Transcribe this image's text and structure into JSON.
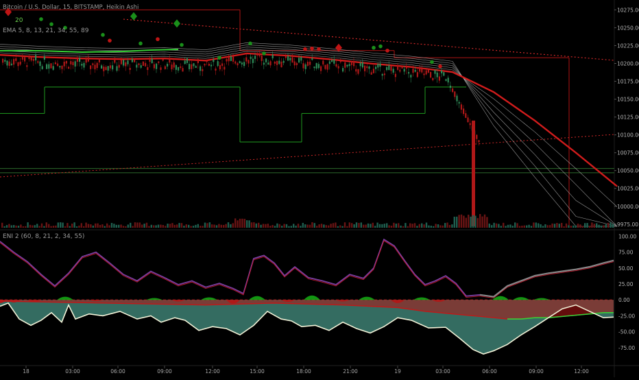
{
  "header": {
    "symbol": "Bitcoin / U.S. Dollar, 15, BITSTAMP, Heikin Ashi",
    "indicator_main": "EMA 5, 8, 13, 21, 34, 55, 89",
    "indicator_sub": "ENI 2 (60, 8, 21, 2, 34, 55)",
    "sub_value": "20"
  },
  "colors": {
    "background": "#000000",
    "up_candle": "#2e8b57",
    "down_candle": "#b01818",
    "ema_slow": "#d11c1c",
    "ema_band": "#c9c9c9",
    "channel": "#1f9d1f",
    "stop_line": "#b01515",
    "dotted_trend": "#d02828",
    "fill_teal": "#3d7f72",
    "fill_red": "#b51515",
    "fill_green": "#14b014",
    "osc_purple": "#7a3ea0",
    "osc_red": "#c0182a"
  },
  "chart_data": [
    {
      "type": "candlestick",
      "title": "Bitcoin / U.S. Dollar, 15, BITSTAMP, Heikin Ashi",
      "y_ticks": [
        "10275.00",
        "10250.00",
        "10225.00",
        "10200.00",
        "10175.00",
        "10150.00",
        "10125.00",
        "10100.00",
        "10075.00",
        "10050.00",
        "10025.00",
        "10000.00",
        "9975.00"
      ],
      "ylim": [
        9970,
        10285
      ],
      "x_ticks": [
        "18",
        "03:00",
        "06:00",
        "09:00",
        "12:00",
        "15:00",
        "18:00",
        "21:00",
        "19",
        "03:00",
        "06:00",
        "09:00",
        "12:00"
      ],
      "ema_slow_points": [
        [
          0,
          10212
        ],
        [
          60,
          10209
        ],
        [
          120,
          10207
        ],
        [
          180,
          10206
        ],
        [
          240,
          10207
        ],
        [
          300,
          10204
        ],
        [
          360,
          10214
        ],
        [
          420,
          10211
        ],
        [
          480,
          10206
        ],
        [
          540,
          10200
        ],
        [
          600,
          10195
        ],
        [
          660,
          10188
        ],
        [
          720,
          10160
        ],
        [
          780,
          10120
        ],
        [
          840,
          10075
        ],
        [
          900,
          10028
        ]
      ],
      "channel_levels": [
        {
          "from": 0,
          "to": 65,
          "value": 10130
        },
        {
          "from": 65,
          "to": 350,
          "value": 10167
        },
        {
          "from": 350,
          "to": 440,
          "value": 10090
        },
        {
          "from": 440,
          "to": 620,
          "value": 10130
        },
        {
          "from": 620,
          "to": 680,
          "value": 10167
        }
      ],
      "stop_levels": [
        {
          "from": 0,
          "to": 350,
          "value": 10275
        },
        {
          "from": 350,
          "to": 575,
          "value": 10218
        },
        {
          "from": 575,
          "to": 830,
          "value": 10208
        }
      ],
      "price_levels": [
        10053,
        10047
      ]
    },
    {
      "type": "area",
      "title": "ENI 2 (60, 8, 21, 2, 34, 55)",
      "y_ticks": [
        "100.00",
        "75.00",
        "50.00",
        "25.00",
        "0.00",
        "-25.00",
        "-50.00",
        "-75.00"
      ],
      "ylim": [
        -100,
        107
      ],
      "osc_points": [
        [
          0,
          -10
        ],
        [
          12,
          -5
        ],
        [
          28,
          -30
        ],
        [
          45,
          -40
        ],
        [
          60,
          -32
        ],
        [
          75,
          -20
        ],
        [
          90,
          -35
        ],
        [
          100,
          -8
        ],
        [
          110,
          -30
        ],
        [
          130,
          -22
        ],
        [
          150,
          -25
        ],
        [
          175,
          -18
        ],
        [
          200,
          -30
        ],
        [
          220,
          -25
        ],
        [
          235,
          -35
        ],
        [
          255,
          -28
        ],
        [
          270,
          -32
        ],
        [
          290,
          -48
        ],
        [
          310,
          -42
        ],
        [
          330,
          -45
        ],
        [
          350,
          -55
        ],
        [
          370,
          -40
        ],
        [
          390,
          -18
        ],
        [
          410,
          -30
        ],
        [
          425,
          -33
        ],
        [
          440,
          -42
        ],
        [
          460,
          -40
        ],
        [
          480,
          -48
        ],
        [
          500,
          -35
        ],
        [
          520,
          -45
        ],
        [
          540,
          -52
        ],
        [
          560,
          -42
        ],
        [
          580,
          -28
        ],
        [
          600,
          -32
        ],
        [
          625,
          -44
        ],
        [
          650,
          -43
        ],
        [
          670,
          -60
        ],
        [
          690,
          -78
        ],
        [
          705,
          -85
        ],
        [
          720,
          -80
        ],
        [
          740,
          -70
        ],
        [
          760,
          -55
        ],
        [
          780,
          -42
        ],
        [
          800,
          -28
        ],
        [
          820,
          -14
        ],
        [
          840,
          -8
        ],
        [
          860,
          -18
        ],
        [
          880,
          -28
        ],
        [
          895,
          -27
        ]
      ],
      "signal_points": [
        [
          0,
          -2
        ],
        [
          100,
          -4
        ],
        [
          200,
          -6
        ],
        [
          300,
          -8
        ],
        [
          400,
          -5
        ],
        [
          500,
          -8
        ],
        [
          580,
          -12
        ],
        [
          620,
          -18
        ],
        [
          660,
          -22
        ],
        [
          700,
          -26
        ],
        [
          740,
          -30
        ],
        [
          760,
          -30
        ],
        [
          780,
          -28
        ],
        [
          800,
          -28
        ],
        [
          820,
          -26
        ],
        [
          840,
          -24
        ],
        [
          860,
          -22
        ],
        [
          880,
          -20
        ],
        [
          895,
          -20
        ]
      ],
      "fast_line": [
        [
          0,
          92
        ],
        [
          20,
          75
        ],
        [
          40,
          60
        ],
        [
          60,
          40
        ],
        [
          80,
          22
        ],
        [
          100,
          42
        ],
        [
          120,
          68
        ],
        [
          140,
          75
        ],
        [
          160,
          58
        ],
        [
          180,
          40
        ],
        [
          200,
          30
        ],
        [
          220,
          45
        ],
        [
          240,
          35
        ],
        [
          260,
          24
        ],
        [
          280,
          30
        ],
        [
          300,
          20
        ],
        [
          320,
          26
        ],
        [
          340,
          18
        ],
        [
          355,
          10
        ],
        [
          370,
          65
        ],
        [
          385,
          70
        ],
        [
          400,
          58
        ],
        [
          415,
          38
        ],
        [
          430,
          52
        ],
        [
          450,
          35
        ],
        [
          470,
          30
        ],
        [
          490,
          24
        ],
        [
          510,
          40
        ],
        [
          530,
          34
        ],
        [
          545,
          50
        ],
        [
          560,
          95
        ],
        [
          575,
          85
        ],
        [
          590,
          62
        ],
        [
          605,
          40
        ],
        [
          620,
          24
        ],
        [
          635,
          30
        ],
        [
          650,
          38
        ],
        [
          665,
          26
        ],
        [
          680,
          6
        ],
        [
          700,
          8
        ],
        [
          720,
          5
        ],
        [
          740,
          22
        ],
        [
          760,
          30
        ],
        [
          780,
          38
        ],
        [
          800,
          42
        ],
        [
          820,
          45
        ],
        [
          840,
          48
        ],
        [
          860,
          52
        ],
        [
          880,
          58
        ],
        [
          895,
          62
        ]
      ],
      "bull_fill": [
        [
          95,
          0,
          10
        ],
        [
          225,
          0,
          6
        ],
        [
          305,
          0,
          8
        ],
        [
          375,
          0,
          12
        ],
        [
          455,
          0,
          14
        ],
        [
          535,
          0,
          10
        ],
        [
          615,
          0,
          8
        ],
        [
          730,
          0,
          12
        ],
        [
          760,
          0,
          9
        ],
        [
          790,
          0,
          6
        ]
      ],
      "bear_fill": [
        [
          0,
          0,
          -10
        ],
        [
          20,
          0,
          -8
        ],
        [
          50,
          0,
          -6
        ],
        [
          140,
          0,
          -4
        ],
        [
          260,
          0,
          -5
        ],
        [
          340,
          0,
          -12
        ],
        [
          420,
          0,
          -6
        ],
        [
          500,
          0,
          -5
        ],
        [
          580,
          0,
          -10
        ],
        [
          640,
          0,
          -6
        ]
      ]
    }
  ]
}
